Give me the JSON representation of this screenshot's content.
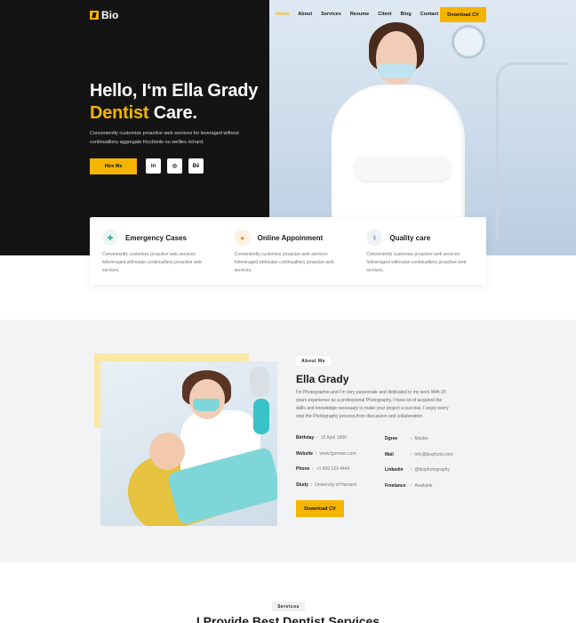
{
  "header": {
    "logo_text": "Bio",
    "nav": [
      "Home",
      "About",
      "Services",
      "Resume",
      "Client",
      "Blog",
      "Contact"
    ],
    "active_nav": "Home",
    "download_cv": "Download CV"
  },
  "hero": {
    "heading_line1": "Hello, I‘m Ella Grady",
    "heading_accent": "Dentist",
    "heading_rest": " Care.",
    "paragraph": "Conveniently customize proactive web services for leveraged without continualliery aggregate fricctionle ou wellies richard.",
    "hire_label": "Hire Me",
    "social": [
      "in",
      "◎",
      "Bē"
    ]
  },
  "features": [
    {
      "icon": "first-aid-kit-icon",
      "glyph": "✚",
      "title": "Emergency Cases",
      "text": "Conveniently customize proactive web services fofeveraged withoutan continualliery proactive web services."
    },
    {
      "icon": "dentist-avatar-icon",
      "glyph": "●",
      "title": "Online Appoinment",
      "text": "Conveniently customize proactive web services fofeveraged withoutan continualliery proactive web services."
    },
    {
      "icon": "dental-chair-icon",
      "glyph": "⚕",
      "title": "Quality care",
      "text": "Conveniently customize proactive web services fofeveraged withoutan continualliery proactive web services."
    }
  ],
  "about": {
    "badge": "About Me",
    "name": "Ella Grady",
    "description": "I'm Photographer,and I'm very passionate and dedicated to my work With 20 years experience as a professional Photography, I have lot of acquired the skills and knowledge necessary to make your project a success. I enjoy every step the Photography process,from discussion and collaboration.",
    "info_left": [
      {
        "key": "Birthday",
        "value": "15 April 1990"
      },
      {
        "key": "Website",
        "value": "www.fgorman.com"
      },
      {
        "key": "Phone",
        "value": "+1 650 123 4444"
      },
      {
        "key": "Study",
        "value": "Univercity of Harvard"
      }
    ],
    "info_right": [
      {
        "key": "Dgree",
        "value": "Master"
      },
      {
        "key": "Mail",
        "value": "info@biophoto.com"
      },
      {
        "key": "Linkedin",
        "value": "@biophotography"
      },
      {
        "key": "Freelance",
        "value": "Available"
      }
    ],
    "download_cv": "Download CV"
  },
  "services": {
    "badge": "Services",
    "title": "I Provide Best Dentist Services"
  },
  "colors": {
    "accent": "#f5b400",
    "dark": "#141414",
    "section_bg": "#f2f3f5"
  }
}
